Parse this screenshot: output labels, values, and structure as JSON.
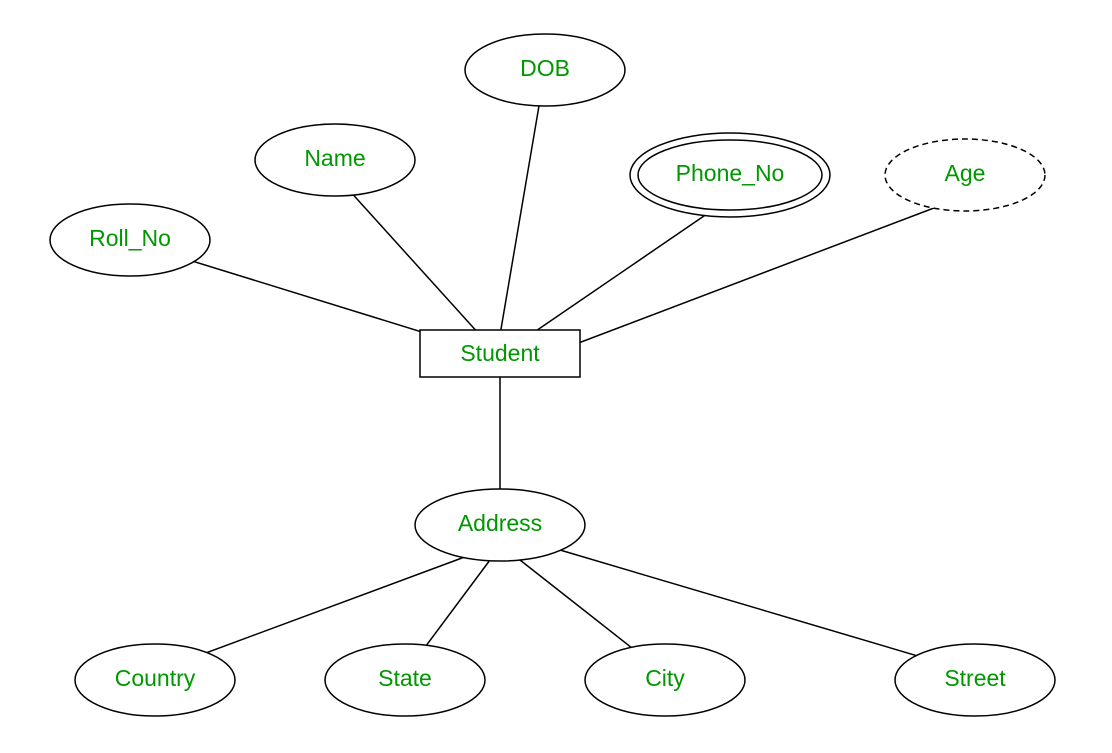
{
  "diagram": {
    "entity": {
      "label": "Student"
    },
    "attributes": {
      "roll_no": {
        "label": "Roll_No"
      },
      "name": {
        "label": "Name"
      },
      "dob": {
        "label": "DOB"
      },
      "phone_no": {
        "label": "Phone_No"
      },
      "age": {
        "label": "Age"
      },
      "address": {
        "label": "Address"
      },
      "country": {
        "label": "Country"
      },
      "state": {
        "label": "State"
      },
      "city": {
        "label": "City"
      },
      "street": {
        "label": "Street"
      }
    },
    "colors": {
      "text": "#009700",
      "stroke": "#000000",
      "background": "#ffffff"
    },
    "attribute_types": {
      "roll_no": "simple",
      "name": "simple",
      "dob": "simple",
      "phone_no": "multivalued",
      "age": "derived",
      "address": "composite",
      "country": "simple",
      "state": "simple",
      "city": "simple",
      "street": "simple"
    }
  }
}
